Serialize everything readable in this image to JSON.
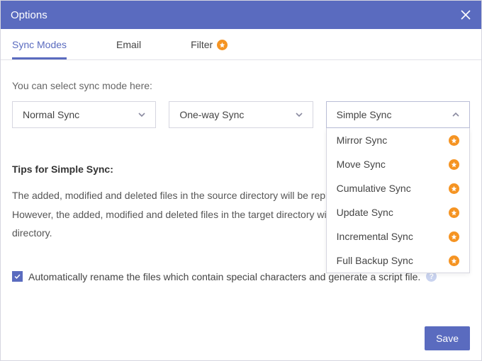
{
  "titlebar": {
    "title": "Options"
  },
  "tabs": [
    {
      "label": "Sync Modes",
      "active": true
    },
    {
      "label": "Email",
      "active": false
    },
    {
      "label": "Filter",
      "active": false,
      "pro": true
    }
  ],
  "hint": "You can select sync mode here:",
  "select1": {
    "value": "Normal Sync"
  },
  "select2": {
    "value": "One-way Sync"
  },
  "select3": {
    "value": "Simple Sync",
    "open": true,
    "options": [
      {
        "label": "Mirror Sync",
        "pro": true
      },
      {
        "label": "Move Sync",
        "pro": true
      },
      {
        "label": "Cumulative Sync",
        "pro": true
      },
      {
        "label": "Update Sync",
        "pro": true
      },
      {
        "label": "Incremental Sync",
        "pro": true
      },
      {
        "label": "Full Backup Sync",
        "pro": true
      }
    ]
  },
  "tips": {
    "title": "Tips for Simple Sync:",
    "body": "The added, modified and deleted files in the source directory will be replicated to the target directory. However, the added, modified and deleted files in the target directory will not be replicated to the source directory."
  },
  "checkbox": {
    "checked": true,
    "label": "Automatically rename the files which contain special characters and generate a script file."
  },
  "help_symbol": "?",
  "footer": {
    "save": "Save"
  }
}
